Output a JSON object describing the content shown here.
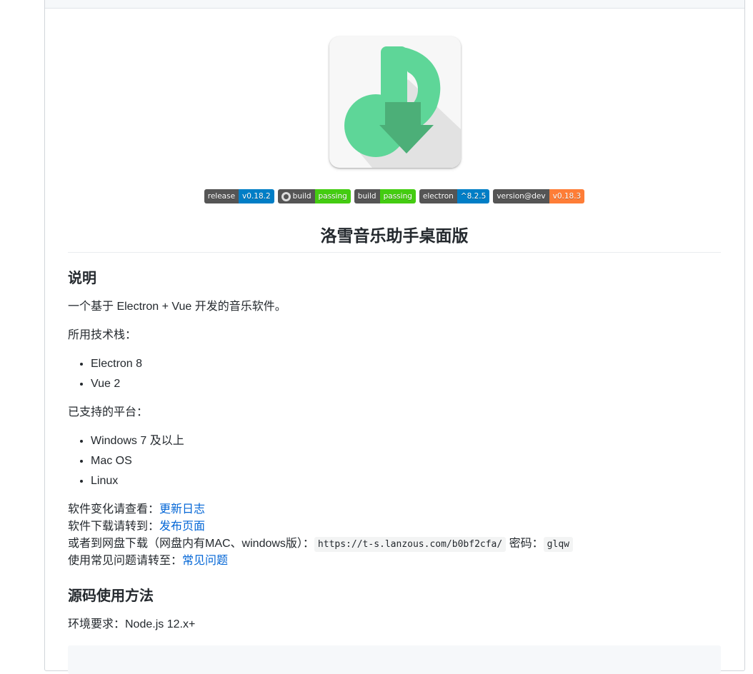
{
  "badges": [
    {
      "label": "release",
      "value": "v0.18.2",
      "color": "#007ec6",
      "icon": ""
    },
    {
      "label": "build",
      "value": "passing",
      "color": "#4c1",
      "icon": "github-actions-icon"
    },
    {
      "label": "build",
      "value": "passing",
      "color": "#4c1",
      "icon": ""
    },
    {
      "label": "electron",
      "value": "^8.2.5",
      "color": "#007ec6",
      "icon": ""
    },
    {
      "label": "version@dev",
      "value": "v0.18.3",
      "color": "#fe7d37",
      "icon": ""
    }
  ],
  "title": "洛雪音乐助手桌面版",
  "section_desc": {
    "heading": "说明",
    "intro": "一个基于 Electron + Vue 开发的音乐软件。",
    "tech_label": "所用技术栈：",
    "tech": [
      "Electron 8",
      "Vue 2"
    ],
    "platform_label": "已支持的平台：",
    "platforms": [
      "Windows 7 及以上",
      "Mac OS",
      "Linux"
    ],
    "changelog_prefix": "软件变化请查看：",
    "changelog_link": "更新日志",
    "download_prefix": "软件下载请转到：",
    "download_link": "发布页面",
    "pan_prefix": "或者到网盘下载（网盘内有MAC、windows版）：",
    "pan_url": "https://t-s.lanzous.com/b0bf2cfa/",
    "pan_pwd_label": "密码：",
    "pan_pwd": "glqw",
    "faq_prefix": "使用常见问题请转至：",
    "faq_link": "常见问题"
  },
  "section_src": {
    "heading": "源码使用方法",
    "env": "环境要求：Node.js 12.x+"
  },
  "colors": {
    "logo_green": "#5ed698",
    "logo_arrow": "#4caf78",
    "link": "#0366d6"
  }
}
